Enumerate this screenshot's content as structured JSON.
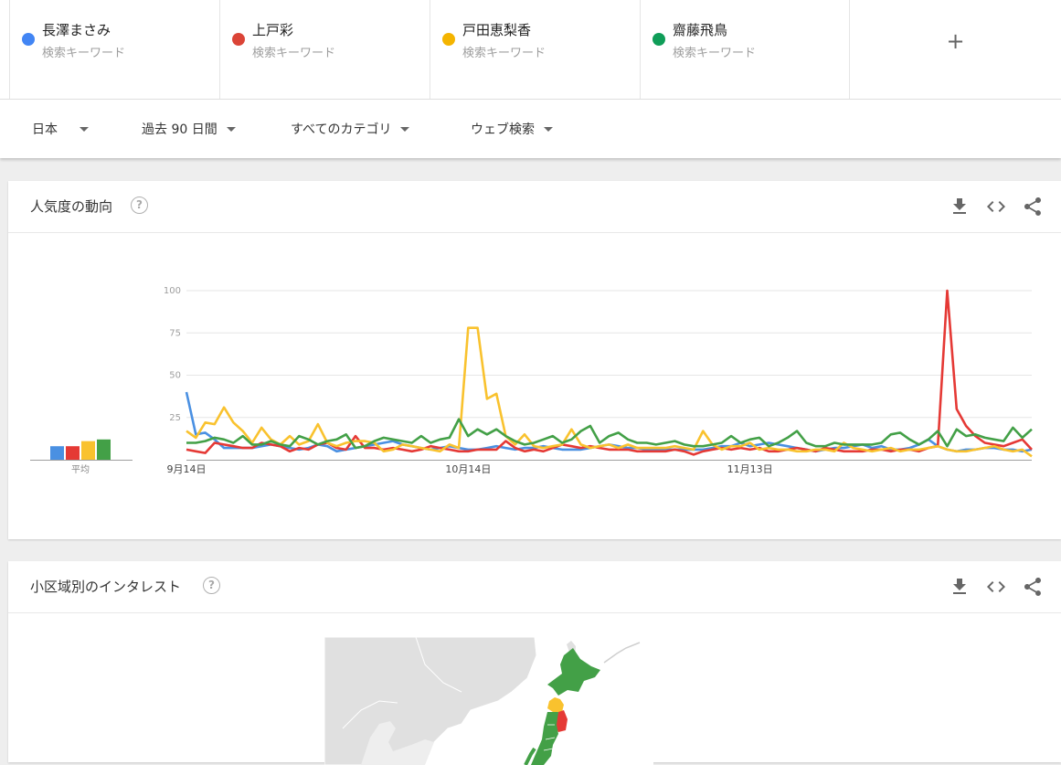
{
  "terms": [
    {
      "name": "長澤まさみ",
      "sub": "検索キーワード",
      "color": "#4285f4"
    },
    {
      "name": "上戸彩",
      "sub": "検索キーワード",
      "color": "#db4437"
    },
    {
      "name": "戸田恵梨香",
      "sub": "検索キーワード",
      "color": "#f4b400"
    },
    {
      "name": "齋藤飛鳥",
      "sub": "検索キーワード",
      "color": "#0f9d58"
    }
  ],
  "add_term_label": "+",
  "filters": {
    "region": "日本",
    "period": "過去 90 日間",
    "category": "すべてのカテゴリ",
    "search_type": "ウェブ検索"
  },
  "interest_card": {
    "title": "人気度の動向",
    "help_icon": "question-circle-icon",
    "icons": [
      "download-icon",
      "embed-code-icon",
      "share-icon"
    ],
    "average_label": "平均"
  },
  "region_card": {
    "title": "小区域別のインタレスト",
    "help_icon": "question-circle-icon",
    "icons": [
      "download-icon",
      "embed-code-icon",
      "share-icon"
    ]
  },
  "chart_data": {
    "type": "line",
    "x_tick_labels": [
      "9月14日",
      "10月14日",
      "11月13日"
    ],
    "x_tick_index": [
      0,
      30,
      60
    ],
    "y_ticks": [
      25,
      50,
      75,
      100
    ],
    "ylim": [
      0,
      100
    ],
    "points": 91,
    "averages": [
      8,
      8,
      11,
      12
    ],
    "series": [
      {
        "name": "長澤まさみ",
        "color": "#4a90e2",
        "values": [
          40,
          15,
          16,
          12,
          7,
          7,
          7,
          7,
          8,
          9,
          8,
          7,
          6,
          7,
          9,
          8,
          5,
          6,
          7,
          8,
          9,
          10,
          11,
          9,
          8,
          7,
          6,
          7,
          8,
          7,
          6,
          6,
          7,
          8,
          7,
          6,
          7,
          7,
          8,
          7,
          6,
          6,
          6,
          7,
          8,
          9,
          8,
          7,
          7,
          6,
          6,
          6,
          6,
          6,
          6,
          6,
          7,
          8,
          8,
          10,
          8,
          9,
          10,
          9,
          8,
          7,
          6,
          5,
          6,
          7,
          7,
          8,
          9,
          7,
          8,
          6,
          6,
          7,
          9,
          12,
          8,
          6,
          5,
          6,
          6,
          7,
          7,
          6,
          6,
          5,
          6
        ]
      },
      {
        "name": "上戸彩",
        "color": "#e53935",
        "values": [
          6,
          5,
          4,
          10,
          9,
          8,
          7,
          7,
          10,
          9,
          8,
          5,
          7,
          6,
          9,
          10,
          7,
          6,
          14,
          7,
          7,
          6,
          7,
          6,
          5,
          6,
          8,
          7,
          6,
          5,
          5,
          6,
          6,
          6,
          11,
          7,
          5,
          6,
          5,
          7,
          9,
          8,
          7,
          8,
          7,
          6,
          6,
          6,
          5,
          5,
          5,
          5,
          6,
          5,
          3,
          5,
          6,
          7,
          6,
          7,
          6,
          7,
          5,
          5,
          6,
          7,
          6,
          5,
          7,
          6,
          5,
          5,
          5,
          6,
          6,
          5,
          6,
          6,
          5,
          7,
          8,
          100,
          30,
          20,
          14,
          10,
          9,
          8,
          10,
          12,
          6
        ]
      },
      {
        "name": "戸田恵梨香",
        "color": "#f9c22e",
        "values": [
          17,
          13,
          22,
          21,
          31,
          22,
          17,
          10,
          19,
          12,
          9,
          14,
          9,
          11,
          21,
          10,
          8,
          10,
          11,
          11,
          10,
          5,
          6,
          9,
          8,
          7,
          6,
          5,
          9,
          7,
          78,
          78,
          36,
          39,
          14,
          9,
          15,
          8,
          7,
          8,
          9,
          18,
          9,
          7,
          8,
          9,
          7,
          9,
          7,
          7,
          7,
          7,
          8,
          7,
          6,
          17,
          9,
          6,
          8,
          8,
          10,
          6,
          7,
          6,
          6,
          5,
          5,
          6,
          6,
          5,
          10,
          7,
          6,
          5,
          6,
          7,
          5,
          6,
          6,
          7,
          8,
          6,
          5,
          5,
          6,
          7,
          8,
          6,
          5,
          6,
          2
        ]
      },
      {
        "name": "齋藤飛鳥",
        "color": "#43a047",
        "values": [
          10,
          10,
          11,
          13,
          12,
          10,
          14,
          9,
          9,
          11,
          9,
          8,
          14,
          12,
          9,
          11,
          12,
          15,
          7,
          8,
          11,
          13,
          12,
          11,
          10,
          14,
          10,
          12,
          13,
          24,
          14,
          18,
          15,
          18,
          14,
          11,
          9,
          10,
          12,
          14,
          10,
          12,
          17,
          20,
          10,
          14,
          16,
          12,
          10,
          10,
          9,
          10,
          11,
          9,
          8,
          8,
          9,
          10,
          14,
          10,
          12,
          13,
          8,
          10,
          13,
          17,
          10,
          8,
          8,
          10,
          9,
          9,
          9,
          9,
          10,
          15,
          16,
          12,
          9,
          12,
          17,
          8,
          18,
          14,
          15,
          13,
          12,
          11,
          19,
          13,
          18
        ]
      }
    ]
  }
}
